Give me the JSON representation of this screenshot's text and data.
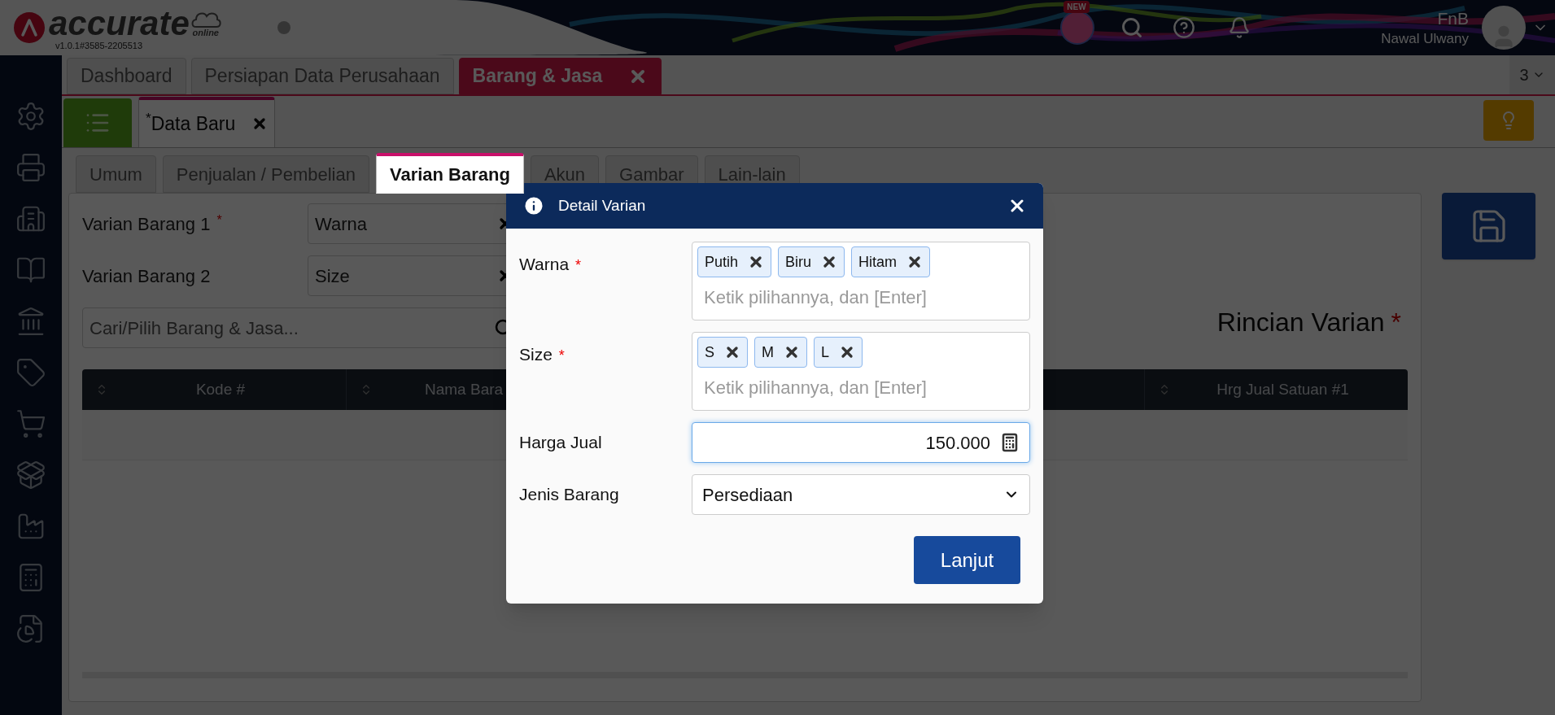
{
  "header": {
    "logo": "accurate",
    "logo_sub": "online",
    "version": "v1.0.1#3585-2205513",
    "badge": "NEW",
    "company": "FnB",
    "user": "Nawal Ulwany"
  },
  "main_tabs": [
    {
      "label": "Dashboard",
      "selected": false,
      "closable": false
    },
    {
      "label": "Persiapan Data Perusahaan",
      "selected": false,
      "closable": false
    },
    {
      "label": "Barang & Jasa",
      "selected": true,
      "closable": true
    }
  ],
  "tab_count": "3",
  "doc_tabs": [
    {
      "label": "$^{*}$Data Baru",
      "selected": true
    }
  ],
  "form_tabs": [
    {
      "label": "Umum",
      "selected": false
    },
    {
      "label": "Penjualan / Pembelian",
      "selected": false
    },
    {
      "label": "Varian Barang",
      "selected": true
    },
    {
      "label": "Akun",
      "selected": false
    },
    {
      "label": "Gambar",
      "selected": false
    },
    {
      "label": "Lain-lain",
      "selected": false
    }
  ],
  "form": {
    "fields": [
      {
        "label": "Varian Barang 1",
        "required_mark": "*",
        "value": "Warna"
      },
      {
        "label": "Varian Barang 2",
        "value": "Size"
      }
    ],
    "search": {
      "placeholder": "Cari/Pilih Barang & Jasa..."
    },
    "section_title": "Rincian Varian",
    "section_required_mark": "*",
    "table": {
      "columns": [
        "Kode #",
        "Nama Bara",
        "Hrg Jual Satuan #1"
      ]
    }
  },
  "modal": {
    "title": "Detail Varian",
    "fields": [
      {
        "kind": "tags",
        "label": "Warna",
        "required_mark": "*",
        "tags": [
          "Putih",
          "Biru",
          "Hitam"
        ],
        "placeholder": "Ketik pilihannya, dan [Enter]"
      },
      {
        "kind": "tags",
        "label": "Size",
        "required_mark": "*",
        "tags": [
          "S",
          "M",
          "L"
        ],
        "placeholder": "Ketik pilihannya, dan [Enter]"
      },
      {
        "kind": "number",
        "label": "Harga Jual",
        "value": "150.000",
        "focused": true
      },
      {
        "kind": "select",
        "label": "Jenis Barang",
        "value": "Persediaan"
      }
    ],
    "button": "Lanjut"
  }
}
